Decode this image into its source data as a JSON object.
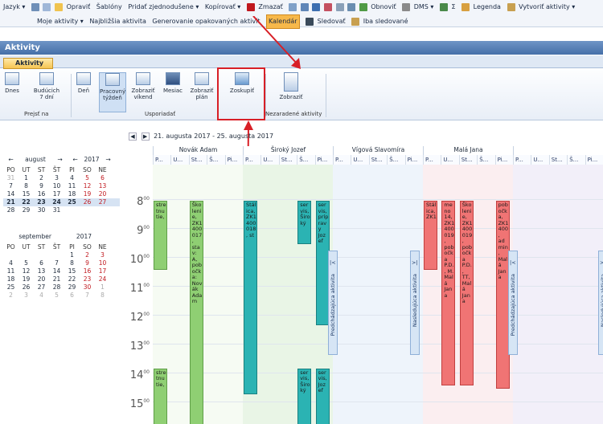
{
  "toolbar": {
    "row1": [
      "Jazyk ▾",
      "Opraviť",
      "Šablóny",
      "Pridať zjednodušene ▾",
      "Kopírovať ▾",
      "Zmazať",
      "Obnoviť",
      "DMS ▾",
      "Σ",
      "Legenda",
      "Vytvoriť aktivity ▾"
    ],
    "row2": [
      "Moje aktivity ▾",
      "Najbližšia aktivita",
      "Generovanie opakovaných aktivít",
      "Kalendár",
      "Sledovať",
      "Iba sledované"
    ]
  },
  "panel_title": "Aktivity",
  "tab": "Aktivity",
  "ribbon": {
    "buttons": [
      "Dnes",
      "Budúcich 7 dní",
      "Deň",
      "Pracovný týždeň",
      "Zobraziť víkend",
      "Mesiac",
      "Zobraziť plán",
      "Zoskupiť",
      "Zobraziť"
    ],
    "groups": [
      "Prejsť na",
      "Usporiadať",
      "Nezaradené aktivity"
    ]
  },
  "cal_august": {
    "month": "august",
    "year": "2017",
    "weekdays": [
      "PO",
      "UT",
      "ST",
      "ŠT",
      "PI",
      "SO",
      "NE"
    ],
    "rows": [
      [
        "31",
        "1",
        "2",
        "3",
        "4",
        "5",
        "6"
      ],
      [
        "7",
        "8",
        "9",
        "10",
        "11",
        "12",
        "13"
      ],
      [
        "14",
        "15",
        "16",
        "17",
        "18",
        "19",
        "20"
      ],
      [
        "21",
        "22",
        "23",
        "24",
        "25",
        "26",
        "27"
      ],
      [
        "28",
        "29",
        "30",
        "31",
        "",
        "",
        ""
      ]
    ]
  },
  "cal_september": {
    "month": "september",
    "year": "2017",
    "weekdays": [
      "PO",
      "UT",
      "ST",
      "ŠT",
      "PI",
      "SO",
      "NE"
    ],
    "rows": [
      [
        "",
        "",
        "",
        "",
        "1",
        "2",
        "3"
      ],
      [
        "4",
        "5",
        "6",
        "7",
        "8",
        "9",
        "10"
      ],
      [
        "11",
        "12",
        "13",
        "14",
        "15",
        "16",
        "17"
      ],
      [
        "18",
        "19",
        "20",
        "21",
        "22",
        "23",
        "24"
      ],
      [
        "25",
        "26",
        "27",
        "28",
        "29",
        "30",
        "1"
      ],
      [
        "2",
        "3",
        "4",
        "5",
        "6",
        "7",
        "8"
      ]
    ]
  },
  "schedule": {
    "range": "21. augusta 2017 - 25. augusta 2017",
    "people": [
      "Novák Adam",
      "Široký Jozef",
      "Vígová Slavomíra",
      "Malá Jana",
      ""
    ],
    "days": [
      "P...",
      "U...",
      "St...",
      "Š...",
      "Pi..."
    ],
    "hours": [
      "8",
      "9",
      "10",
      "11",
      "12",
      "13",
      "14",
      "15",
      "16"
    ],
    "min": "00",
    "prev_label": "Predchádzajúca aktivita",
    "next_label": "Nasledujúca aktivita",
    "prev_arrow": "|<",
    "next_arrow": ">|",
    "events": {
      "e1": "stretnutie,",
      "e2": "Školenie, ZK1400017, stav: A, pobočka: Novák Adam",
      "e3": "Stálica, ZK1400018, st",
      "e4": "servis, Široký",
      "e5": "servis, prípravy Jozef",
      "e6": "stretnutie,",
      "e7": "servis, Široký",
      "e8": "servis, Jozef",
      "e9": "Stálica, ZK1",
      "e10": "meno 14, ZK1400019, pobočka P.D., M. Malá Jana",
      "e11": "Školenie, ZK1400019, pobočka P.D., TT, Malá Jana",
      "e12": "pobočka, ZK1400, admin, Malá Jana"
    }
  },
  "colors": {
    "accent": "#456fa8",
    "callout": "#d81f26",
    "green_event": "#8fcf73",
    "teal_event": "#2bb3b3",
    "red_event": "#f07474"
  }
}
